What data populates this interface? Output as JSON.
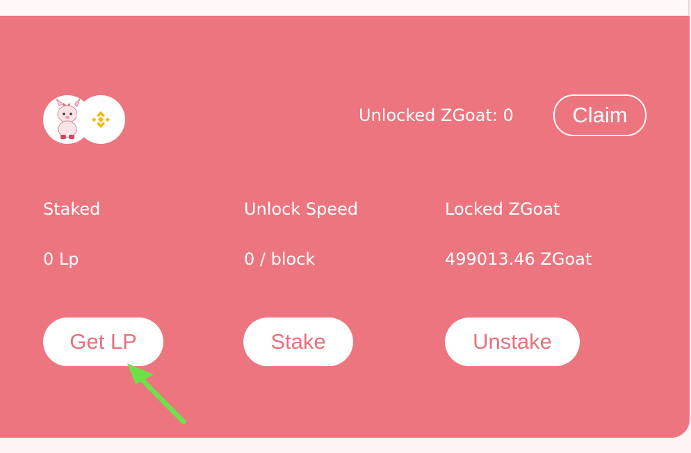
{
  "header": {
    "unlocked_label": "Unlocked ZGoat: 0",
    "claim_label": "Claim"
  },
  "pair": {
    "token_a_icon": "goat-mascot-icon",
    "token_b_icon": "bnb-icon"
  },
  "stats": [
    {
      "label": "Staked",
      "value": "0 Lp"
    },
    {
      "label": "Unlock Speed",
      "value": "0 / block"
    },
    {
      "label": "Locked ZGoat",
      "value": "499013.46 ZGoat"
    }
  ],
  "actions": {
    "get_lp_label": "Get LP",
    "stake_label": "Stake",
    "unstake_label": "Unstake"
  },
  "colors": {
    "card_bg": "#ed7580",
    "button_text": "#e8707b",
    "arrow": "#6ee04a",
    "bnb_yellow": "#f0b90b"
  }
}
